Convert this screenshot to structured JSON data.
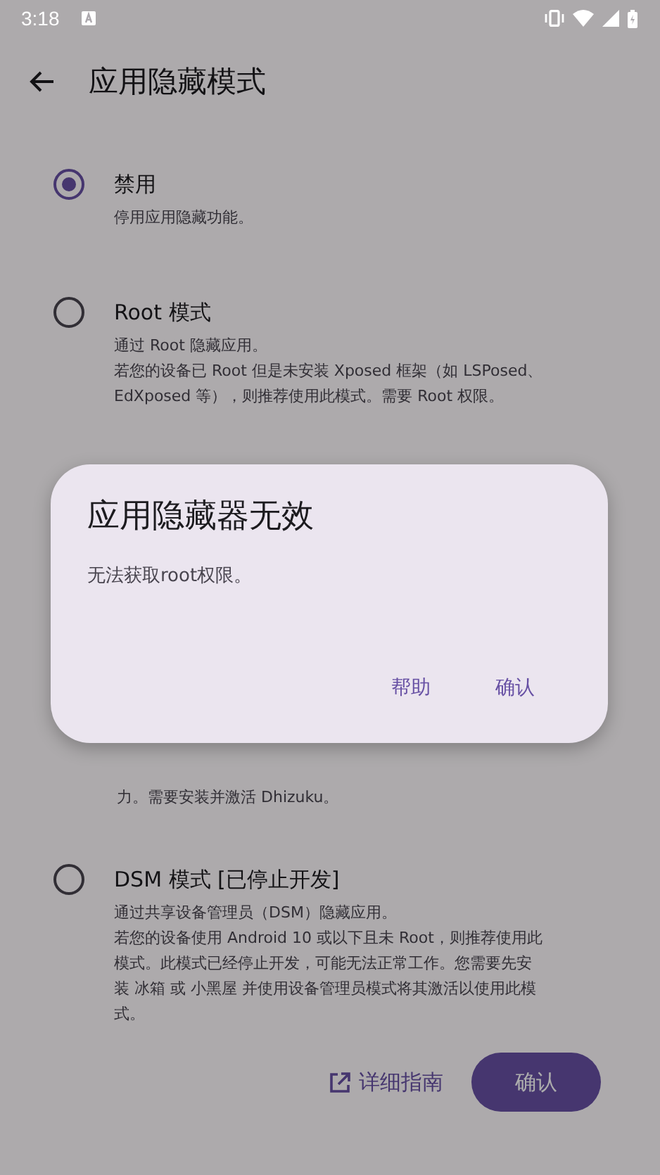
{
  "status_bar": {
    "time": "3:18"
  },
  "top_bar": {
    "title": "应用隐藏模式"
  },
  "options": [
    {
      "kind": "full",
      "title": "禁用",
      "description": [
        "停用应用隐藏功能。"
      ],
      "selected": true
    },
    {
      "kind": "full",
      "title": "Root 模式",
      "description": [
        "通过 Root 隐藏应用。",
        "若您的设备已 Root 但是未安装 Xposed 框架（如 LSPosed、EdXposed 等），则推荐使用此模式。需要 Root 权限。"
      ],
      "selected": false
    },
    {
      "kind": "covered",
      "description": [
        "力。需要安装并激活 Dhizuku。"
      ]
    },
    {
      "kind": "full",
      "title": "DSM 模式 [已停止开发]",
      "description": [
        "通过共享设备管理员（DSM）隐藏应用。",
        "若您的设备使用 Android 10 或以下且未 Root，则推荐使用此模式。此模式已经停止开发，可能无法正常工作。您需要先安装 冰箱 或 小黑屋 并使用设备管理员模式将其激活以使用此模式。"
      ],
      "selected": false
    }
  ],
  "footer": {
    "link": "详细指南",
    "button": "确认"
  },
  "dialog": {
    "title": "应用隐藏器无效",
    "message": "无法获取root权限。",
    "buttons": [
      "帮助",
      "确认"
    ]
  }
}
